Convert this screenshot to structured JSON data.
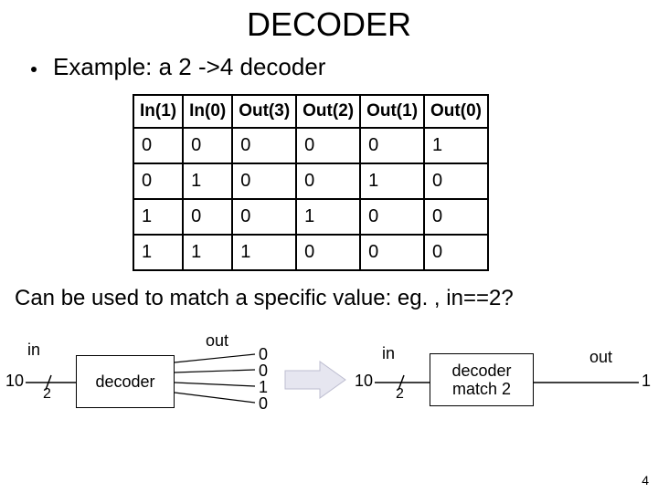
{
  "title": "DECODER",
  "bullet": "Example: a 2 ->4 decoder",
  "table": {
    "headers": [
      "In(1)",
      "In(0)",
      "Out(3)",
      "Out(2)",
      "Out(1)",
      "Out(0)"
    ],
    "rows": [
      [
        "0",
        "0",
        "0",
        "0",
        "0",
        "1"
      ],
      [
        "0",
        "1",
        "0",
        "0",
        "1",
        "0"
      ],
      [
        "1",
        "0",
        "0",
        "1",
        "0",
        "0"
      ],
      [
        "1",
        "1",
        "1",
        "0",
        "0",
        "0"
      ]
    ]
  },
  "caption": "Can be used to match a specific value: eg. , in==2?",
  "diagram": {
    "in_label": "in",
    "in_value": "10",
    "bus_width": "2",
    "decoder1_label": "decoder",
    "out_label": "out",
    "out_bits": [
      "0",
      "0",
      "1",
      "0"
    ],
    "in2_label": "in",
    "in2_value": "10",
    "bus2_width": "2",
    "decoder2_line1": "decoder",
    "decoder2_line2": "match 2",
    "out2_label": "out",
    "out2_value": "1"
  },
  "page_number": "4"
}
